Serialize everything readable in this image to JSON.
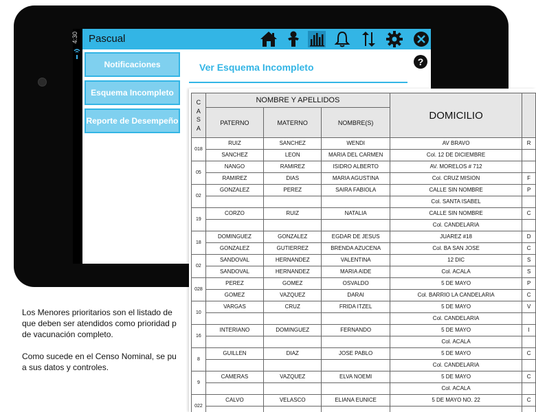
{
  "status_bar": {
    "time": "4:30"
  },
  "app": {
    "title": "Pascual"
  },
  "icons": {
    "home": "home-icon",
    "child": "child-icon",
    "chart": "bar-chart-icon",
    "bell": "bell-icon",
    "sync": "sync-arrows-icon",
    "settings": "gear-icon",
    "close": "close-icon",
    "help": "help-icon"
  },
  "sidebar": {
    "items": [
      {
        "label": "Notificaciones"
      },
      {
        "label": "Esquema Incompleto"
      },
      {
        "label": "Reporte de Desempeño"
      }
    ]
  },
  "panel": {
    "title": "Ver Esquema Incompleto"
  },
  "caption": {
    "p1": "Los Menores prioritarios son el listado de que deben ser atendidos como prioridad p de vacunación completo.",
    "p1_lines": [
      "Los Menores prioritarios son el listado de",
      "que deben ser atendidos como prioridad p",
      "de vacunación completo."
    ],
    "p2_lines": [
      "Como sucede en el Censo Nominal, se pu",
      "a sus datos y controles."
    ]
  },
  "census": {
    "header": {
      "casa": [
        "C",
        "A",
        "S",
        "A"
      ],
      "nombre_y_apellidos": "NOMBRE Y APELLIDOS",
      "paterno": "PATERNO",
      "materno": "MATERNO",
      "nombres": "NOMBRE(S)",
      "domicilio": "DOMICILIO"
    },
    "groups": [
      {
        "casa": "018",
        "rows": [
          {
            "paterno": "RUIZ",
            "materno": "SANCHEZ",
            "nombre": "WENDI",
            "domicilio": "AV BRAVO",
            "extra": "R"
          },
          {
            "paterno": "SANCHEZ",
            "materno": "LEON",
            "nombre": "MARIA DEL CARMEN",
            "domicilio": "Col. 12 DE DICIEMBRE",
            "extra": ""
          }
        ]
      },
      {
        "casa": "05",
        "rows": [
          {
            "paterno": "NANGO",
            "materno": "RAMIREZ",
            "nombre": "ISIDRO ALBERTO",
            "domicilio": "AV. MORELOS # 712",
            "extra": ""
          },
          {
            "paterno": "RAMIREZ",
            "materno": "DIAS",
            "nombre": "MARIA AGUSTINA",
            "domicilio": "Col. CRUZ MISION",
            "extra": "F"
          }
        ]
      },
      {
        "casa": "02",
        "rows": [
          {
            "paterno": "GONZALEZ",
            "materno": "PEREZ",
            "nombre": "SAIRA FABIOLA",
            "domicilio": "CALLE SIN NOMBRE",
            "extra": "P"
          },
          {
            "paterno": "",
            "materno": "",
            "nombre": "",
            "domicilio": "Col. SANTA ISABEL",
            "extra": ""
          }
        ]
      },
      {
        "casa": "19",
        "rows": [
          {
            "paterno": "CORZO",
            "materno": "RUIZ",
            "nombre": "NATALIA",
            "domicilio": "CALLE SIN NOMBRE",
            "extra": "C"
          },
          {
            "paterno": "",
            "materno": "",
            "nombre": "",
            "domicilio": "Col. CANDELARIA",
            "extra": ""
          }
        ]
      },
      {
        "casa": "18",
        "rows": [
          {
            "paterno": "DOMINGUEZ",
            "materno": "GONZALEZ",
            "nombre": "EGDAR DE JESUS",
            "domicilio": "JUAREZ #18",
            "extra": "D"
          },
          {
            "paterno": "GONZALEZ",
            "materno": "GUTIERREZ",
            "nombre": "BRENDA AZUCENA",
            "domicilio": "Col. BA SAN JOSE",
            "extra": "C"
          }
        ]
      },
      {
        "casa": "02",
        "rows": [
          {
            "paterno": "SANDOVAL",
            "materno": "HERNANDEZ",
            "nombre": "VALENTINA",
            "domicilio": "12 DIC",
            "extra": "S"
          },
          {
            "paterno": "SANDOVAL",
            "materno": "HERNANDEZ",
            "nombre": "MARIA AIDE",
            "domicilio": "Col. ACALA",
            "extra": "S"
          }
        ]
      },
      {
        "casa": "028",
        "rows": [
          {
            "paterno": "PEREZ",
            "materno": "GOMEZ",
            "nombre": "OSVALDO",
            "domicilio": "5 DE MAYO",
            "extra": "P"
          },
          {
            "paterno": "GOMEZ",
            "materno": "VAZQUEZ",
            "nombre": "DARAI",
            "domicilio": "Col. BARRIO LA CANDELARIA",
            "extra": "C"
          }
        ]
      },
      {
        "casa": "10",
        "rows": [
          {
            "paterno": "VARGAS",
            "materno": "CRUZ",
            "nombre": "FRIDA ITZEL",
            "domicilio": "5 DE MAYO",
            "extra": "V"
          },
          {
            "paterno": "",
            "materno": "",
            "nombre": "",
            "domicilio": "Col. CANDELARIA",
            "extra": ""
          }
        ]
      },
      {
        "casa": "16",
        "rows": [
          {
            "paterno": "INTERIANO",
            "materno": "DOMINGUEZ",
            "nombre": "FERNANDO",
            "domicilio": "5 DE MAYO",
            "extra": "I"
          },
          {
            "paterno": "",
            "materno": "",
            "nombre": "",
            "domicilio": "Col. ACALA",
            "extra": ""
          }
        ]
      },
      {
        "casa": "8",
        "rows": [
          {
            "paterno": "GUILLEN",
            "materno": "DIAZ",
            "nombre": "JOSE PABLO",
            "domicilio": "5 DE MAYO",
            "extra": "C"
          },
          {
            "paterno": "",
            "materno": "",
            "nombre": "",
            "domicilio": "Col. CANDELARIA",
            "extra": ""
          }
        ]
      },
      {
        "casa": "9",
        "rows": [
          {
            "paterno": "CAMERAS",
            "materno": "VAZQUEZ",
            "nombre": "ELVA NOEMI",
            "domicilio": "5 DE MAYO",
            "extra": "C"
          },
          {
            "paterno": "",
            "materno": "",
            "nombre": "",
            "domicilio": "Col. ACALA",
            "extra": ""
          }
        ]
      },
      {
        "casa": "022",
        "rows": [
          {
            "paterno": "CALVO",
            "materno": "VELASCO",
            "nombre": "ELIANA EUNICE",
            "domicilio": "5 DE MAYO NO. 22",
            "extra": "C"
          },
          {
            "paterno": "",
            "materno": "",
            "nombre": "",
            "domicilio": "",
            "extra": ""
          }
        ]
      }
    ]
  }
}
